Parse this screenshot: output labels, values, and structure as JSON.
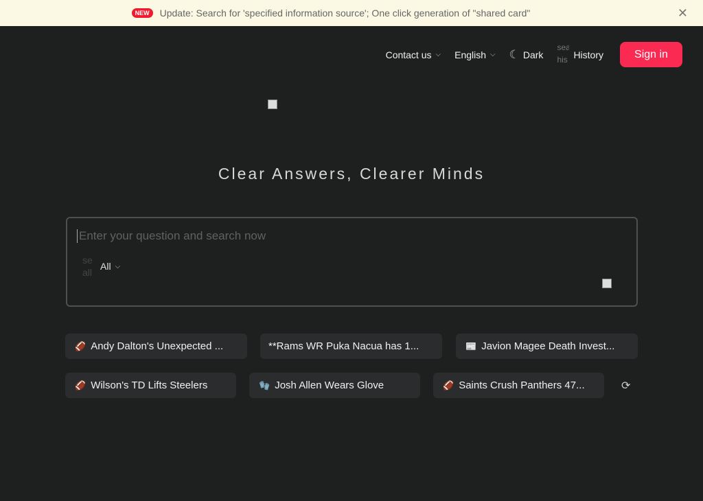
{
  "banner": {
    "badge": "NEW",
    "text": "Update: Search for 'specified information source'; One click generation of \"shared card\"",
    "close_icon": "close-icon"
  },
  "nav": {
    "contact": "Contact us",
    "language": "English",
    "theme": "Dark",
    "history_alt": "sea his",
    "history": "History",
    "signin": "Sign in"
  },
  "hero": {
    "title": "Clear Answers, Clearer Minds"
  },
  "search": {
    "placeholder": "Enter your question and search now",
    "value": "",
    "source_alt": "se all",
    "source": "All"
  },
  "suggestions": [
    {
      "icon": "🏈",
      "label": "Andy Dalton's Unexpected ..."
    },
    {
      "icon": "",
      "label": "**Rams WR Puka Nacua has 1..."
    },
    {
      "icon": "📰",
      "label": "Javion Magee Death Invest..."
    },
    {
      "icon": "🏈",
      "label": "Wilson's TD Lifts Steelers"
    },
    {
      "icon": "🧤",
      "label": "Josh Allen Wears Glove"
    },
    {
      "icon": "🏈",
      "label": "Saints Crush Panthers 47..."
    }
  ],
  "colors": {
    "accent": "#fb2a52",
    "background": "#1e1f1f",
    "banner": "#fbf9e4"
  }
}
